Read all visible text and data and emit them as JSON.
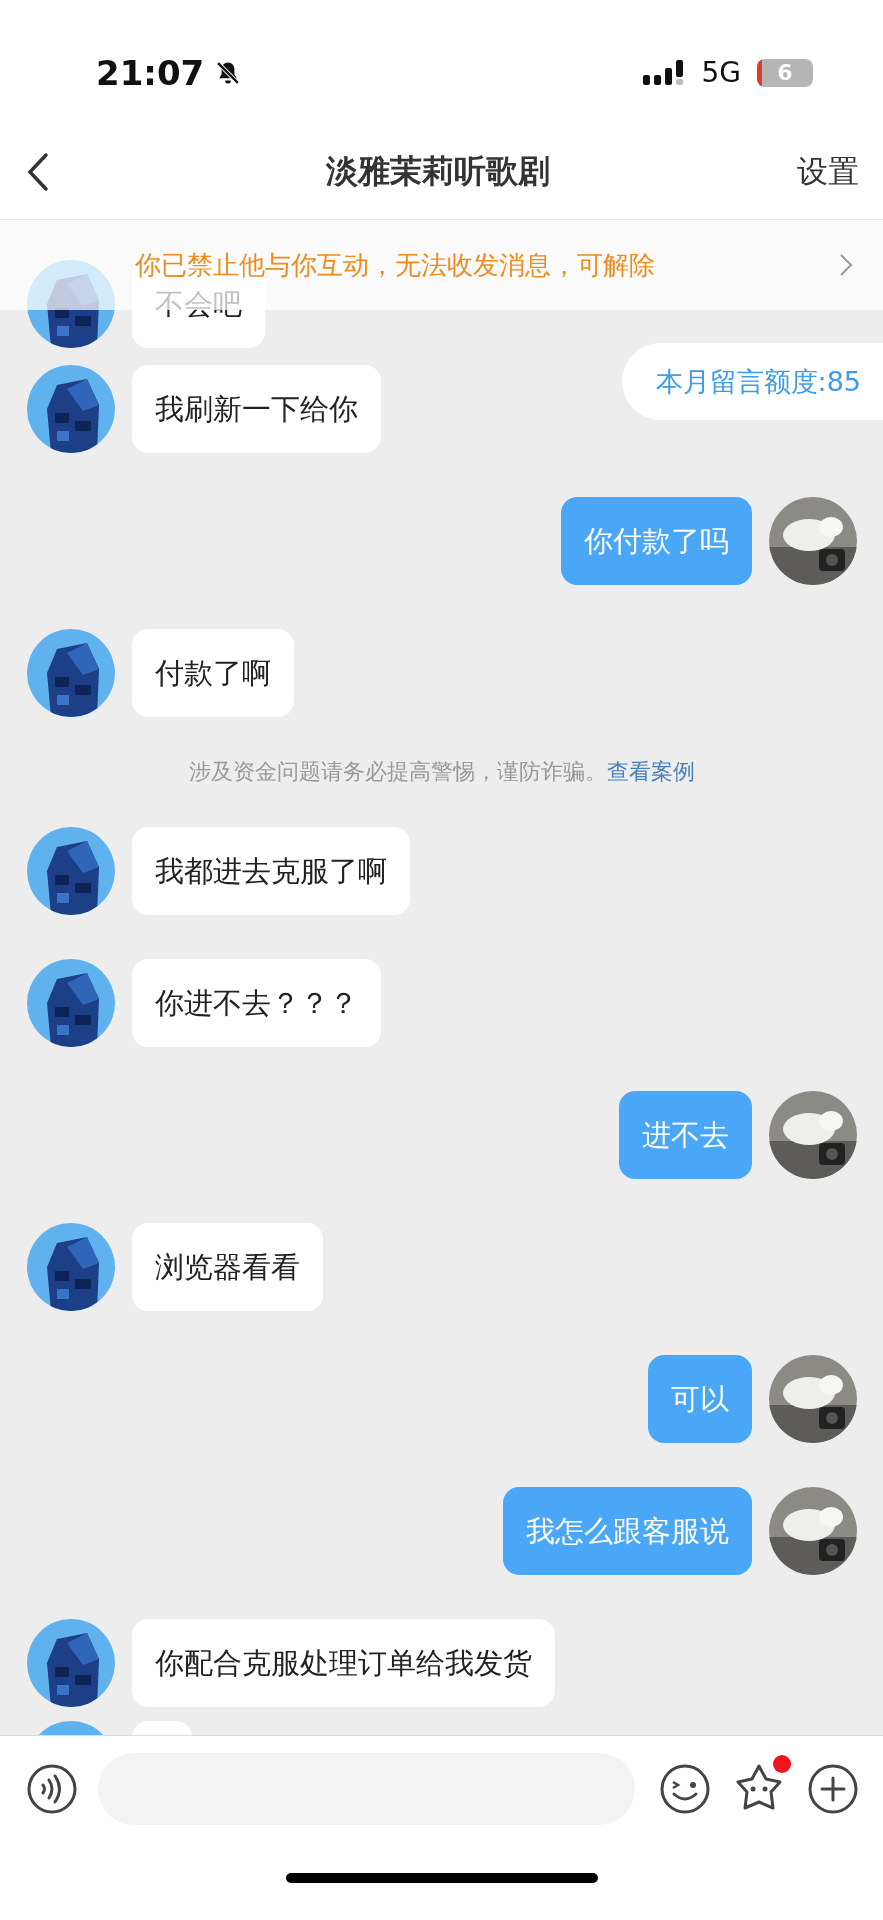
{
  "status_bar": {
    "time": "21:07",
    "network": "5G",
    "battery": "6"
  },
  "nav": {
    "title": "淡雅茉莉听歌剧",
    "action": "设置"
  },
  "banner": {
    "text": "你已禁止他与你互动，无法收发消息，可解除"
  },
  "quota": {
    "text": "本月留言额度:85"
  },
  "messages": [
    {
      "kind": "incoming",
      "text": "不会吧"
    },
    {
      "kind": "incoming",
      "text": "我刷新一下给你"
    },
    {
      "kind": "outgoing",
      "text": "你付款了吗"
    },
    {
      "kind": "incoming",
      "text": "付款了啊"
    },
    {
      "kind": "notice",
      "text": "涉及资金问题请务必提高警惕，谨防诈骗。",
      "link": "查看案例"
    },
    {
      "kind": "incoming",
      "text": "我都进去克服了啊"
    },
    {
      "kind": "incoming",
      "text": "你进不去？？？"
    },
    {
      "kind": "outgoing",
      "text": "进不去"
    },
    {
      "kind": "incoming",
      "text": "浏览器看看"
    },
    {
      "kind": "outgoing",
      "text": "可以"
    },
    {
      "kind": "outgoing",
      "text": "我怎么跟客服说"
    },
    {
      "kind": "incoming",
      "text": "你配合克服处理订单给我发货"
    },
    {
      "kind": "incoming"
    }
  ],
  "input_bar": {
    "sticker_unread": true
  }
}
